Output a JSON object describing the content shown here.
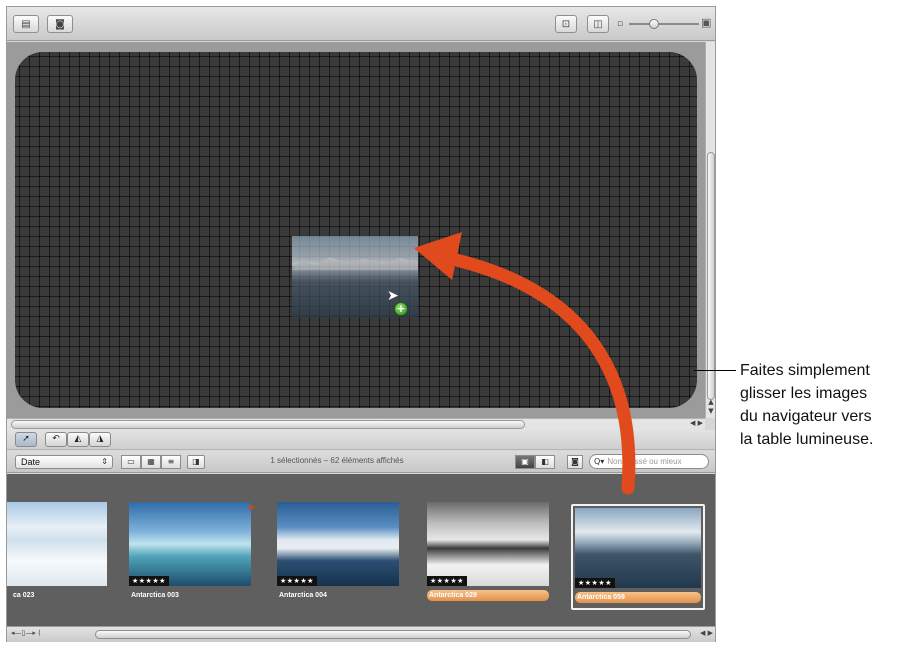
{
  "toolbar": {
    "left_buttons": [
      {
        "icon": "grid-arrange-icon"
      },
      {
        "icon": "camera-import-icon"
      }
    ],
    "right_buttons": [
      {
        "icon": "zoom-fit-icon"
      },
      {
        "icon": "layout-toggle-icon"
      }
    ],
    "zoom_slider_icons": [
      "small-size-icon",
      "large-size-icon"
    ]
  },
  "light_table": {
    "placed_photo": "Antarctica 059"
  },
  "tools": [
    "pointer-icon",
    "lift-tool-icon",
    "stamp-tool-icon",
    "brush-tool-icon"
  ],
  "filter_bar": {
    "sort_label": "Date",
    "status": "1 sélectionnés – 62 éléments affichés",
    "search_placeholder": "Non classé ou mieux"
  },
  "browser": {
    "thumbnails": [
      {
        "caption": "ca 023",
        "stars": "★",
        "highlighted": false,
        "selected": false
      },
      {
        "caption": "Antarctica 003",
        "stars": "★★★★★",
        "highlighted": false,
        "selected": false,
        "flagged": true
      },
      {
        "caption": "Antarctica 004",
        "stars": "★★★★★",
        "highlighted": false,
        "selected": false
      },
      {
        "caption": "Antarctica 029",
        "stars": "★★★★★",
        "highlighted": true,
        "selected": false
      },
      {
        "caption": "Antarctica 059",
        "stars": "★★★★★",
        "highlighted": true,
        "selected": true
      }
    ]
  },
  "callout": {
    "lines": [
      "Faites simplement",
      "glisser les images",
      "du navigateur vers",
      "la table lumineuse."
    ]
  },
  "colors": {
    "arrow": "#e04a1c",
    "highlight": "#e9a060",
    "lighttable_bg": "#3a3a3a"
  }
}
